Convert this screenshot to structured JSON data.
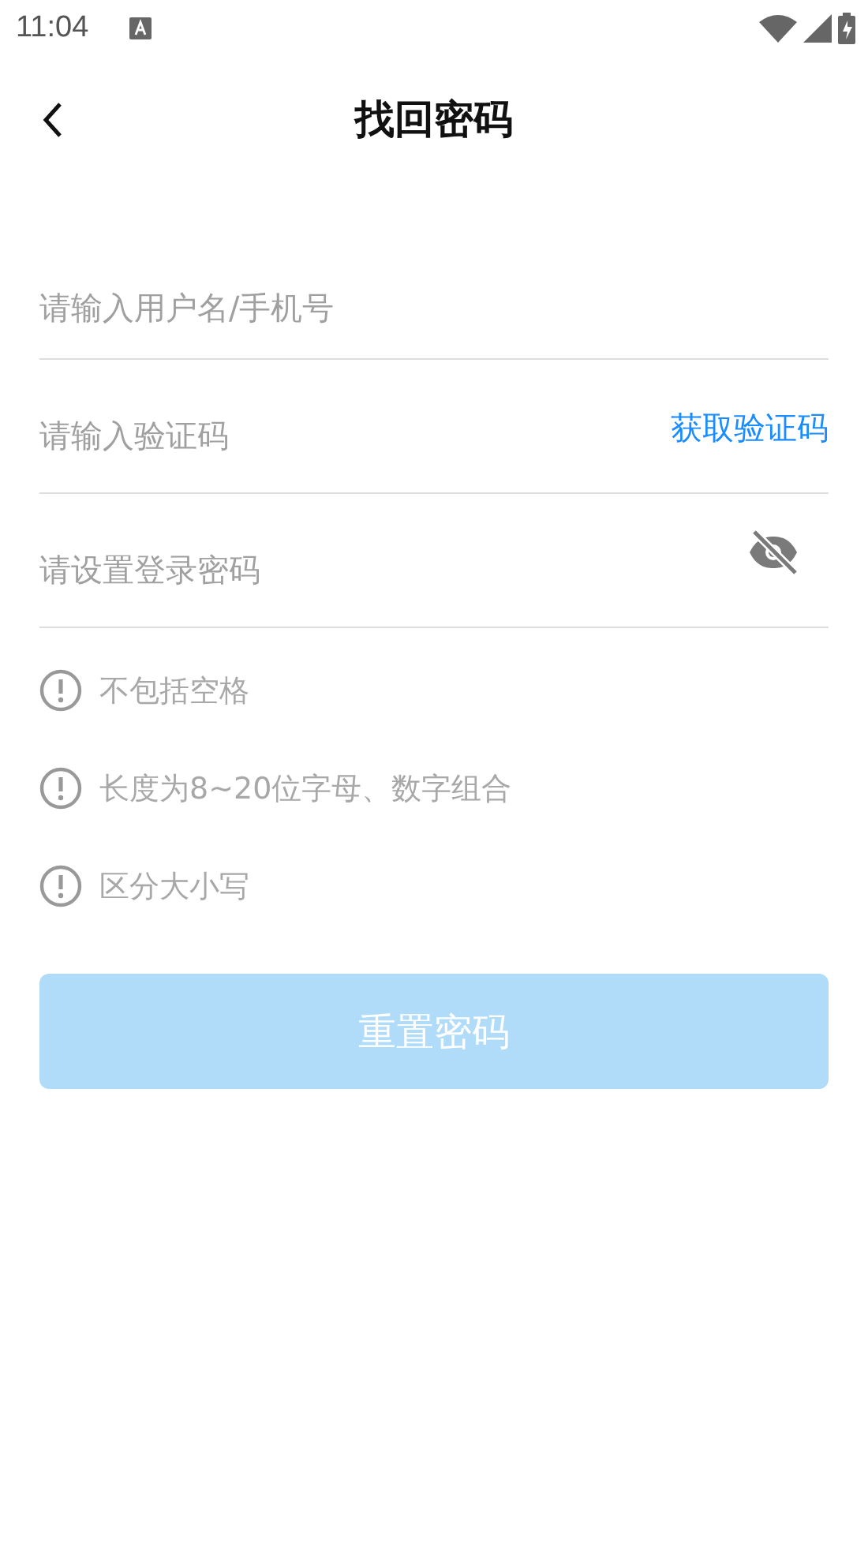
{
  "status_bar": {
    "time": "11:04"
  },
  "header": {
    "title": "找回密码"
  },
  "fields": [
    {
      "kind": "text",
      "placeholder": "请输入用户名/手机号"
    },
    {
      "kind": "code",
      "placeholder": "请输入验证码",
      "action": "获取验证码"
    },
    {
      "kind": "password",
      "placeholder": "请设置登录密码"
    }
  ],
  "hints": [
    "不包括空格",
    "长度为8~20位字母、数字组合",
    "区分大小写"
  ],
  "submit": {
    "label": "重置密码",
    "disabled": true
  }
}
